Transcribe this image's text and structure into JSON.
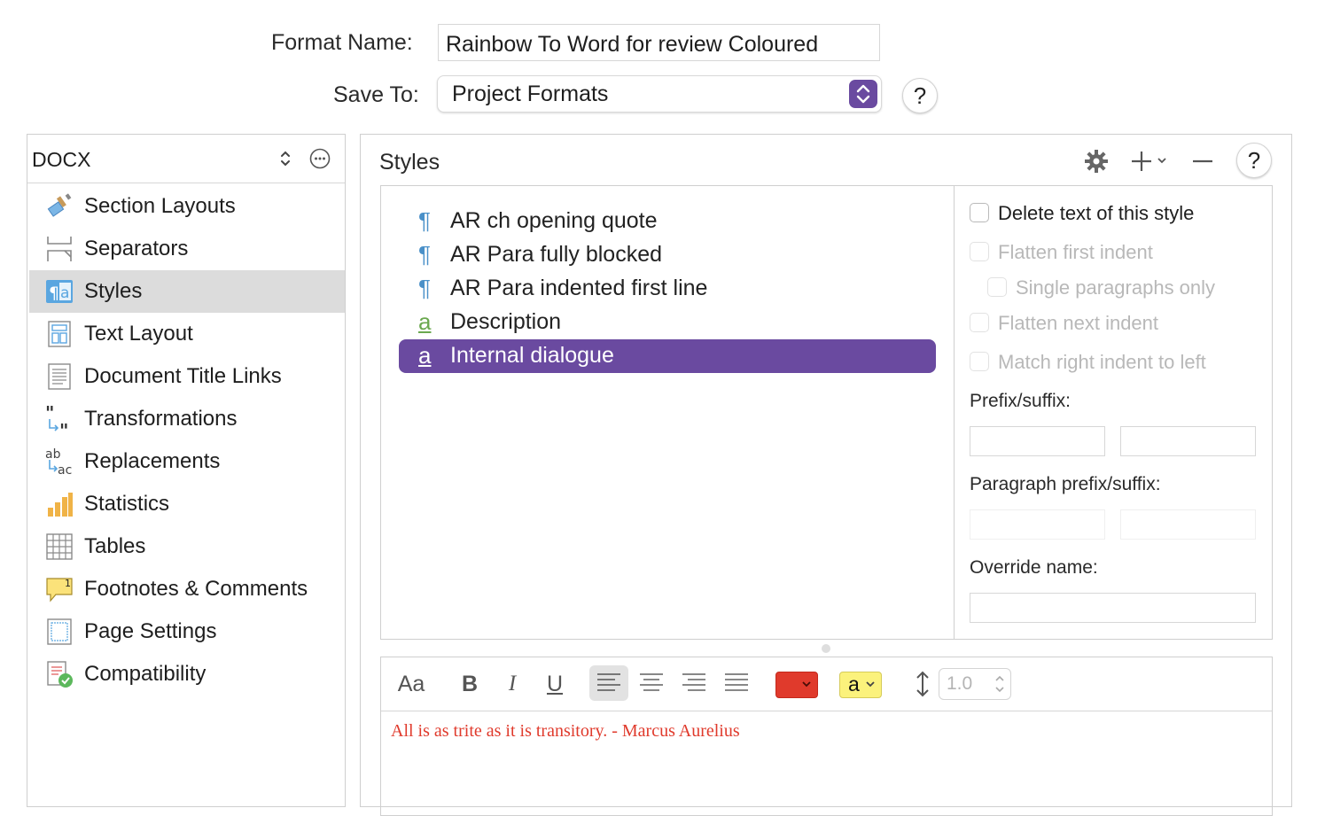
{
  "header": {
    "format_name_label": "Format Name:",
    "format_name_value": "Rainbow To Word for review Coloured",
    "save_to_label": "Save To:",
    "save_to_value": "Project Formats",
    "help_label": "?"
  },
  "sidebar": {
    "format_type": "DOCX",
    "items": [
      {
        "label": "Section Layouts",
        "icon": "paintbrush-icon"
      },
      {
        "label": "Separators",
        "icon": "separators-icon"
      },
      {
        "label": "Styles",
        "icon": "styles-icon"
      },
      {
        "label": "Text Layout",
        "icon": "text-layout-icon"
      },
      {
        "label": "Document Title Links",
        "icon": "document-icon"
      },
      {
        "label": "Transformations",
        "icon": "quotes-transform-icon"
      },
      {
        "label": "Replacements",
        "icon": "replacements-icon"
      },
      {
        "label": "Statistics",
        "icon": "bar-chart-icon"
      },
      {
        "label": "Tables",
        "icon": "table-icon"
      },
      {
        "label": "Footnotes & Comments",
        "icon": "footnote-icon"
      },
      {
        "label": "Page Settings",
        "icon": "page-settings-icon"
      },
      {
        "label": "Compatibility",
        "icon": "compatibility-icon"
      }
    ],
    "selected": "Styles"
  },
  "styles_panel": {
    "title": "Styles",
    "help_label": "?",
    "list": [
      {
        "name": "AR ch opening quote",
        "kind": "paragraph",
        "glyph": "¶"
      },
      {
        "name": "AR Para fully blocked",
        "kind": "paragraph",
        "glyph": "¶"
      },
      {
        "name": "AR Para indented first line",
        "kind": "paragraph",
        "glyph": "¶"
      },
      {
        "name": "Description",
        "kind": "character",
        "glyph": "a"
      },
      {
        "name": "Internal dialogue",
        "kind": "character",
        "glyph": "a"
      }
    ],
    "selected": "Internal dialogue",
    "options": {
      "delete_text": "Delete text of this style",
      "flatten_first_indent": "Flatten first indent",
      "single_paragraphs_only": "Single paragraphs only",
      "flatten_next_indent": "Flatten next indent",
      "match_right_indent": "Match right indent to left",
      "prefix_suffix_label": "Prefix/suffix:",
      "paragraph_prefix_suffix_label": "Paragraph prefix/suffix:",
      "override_name_label": "Override name:"
    }
  },
  "format_bar": {
    "font_label": "Aa",
    "bold_label": "B",
    "italic_label": "I",
    "underline_label": "U",
    "text_color": "#e03a2c",
    "highlight_glyph": "a",
    "highlight_color": "#fbf27c",
    "line_spacing": "1.0"
  },
  "preview": {
    "text": "All is as trite as it is transitory. - Marcus Aurelius",
    "color": "#e03a2c"
  },
  "colors": {
    "accent": "#6a4aa0",
    "paragraph_icon": "#4a90c8",
    "character_icon": "#6aa84f"
  }
}
